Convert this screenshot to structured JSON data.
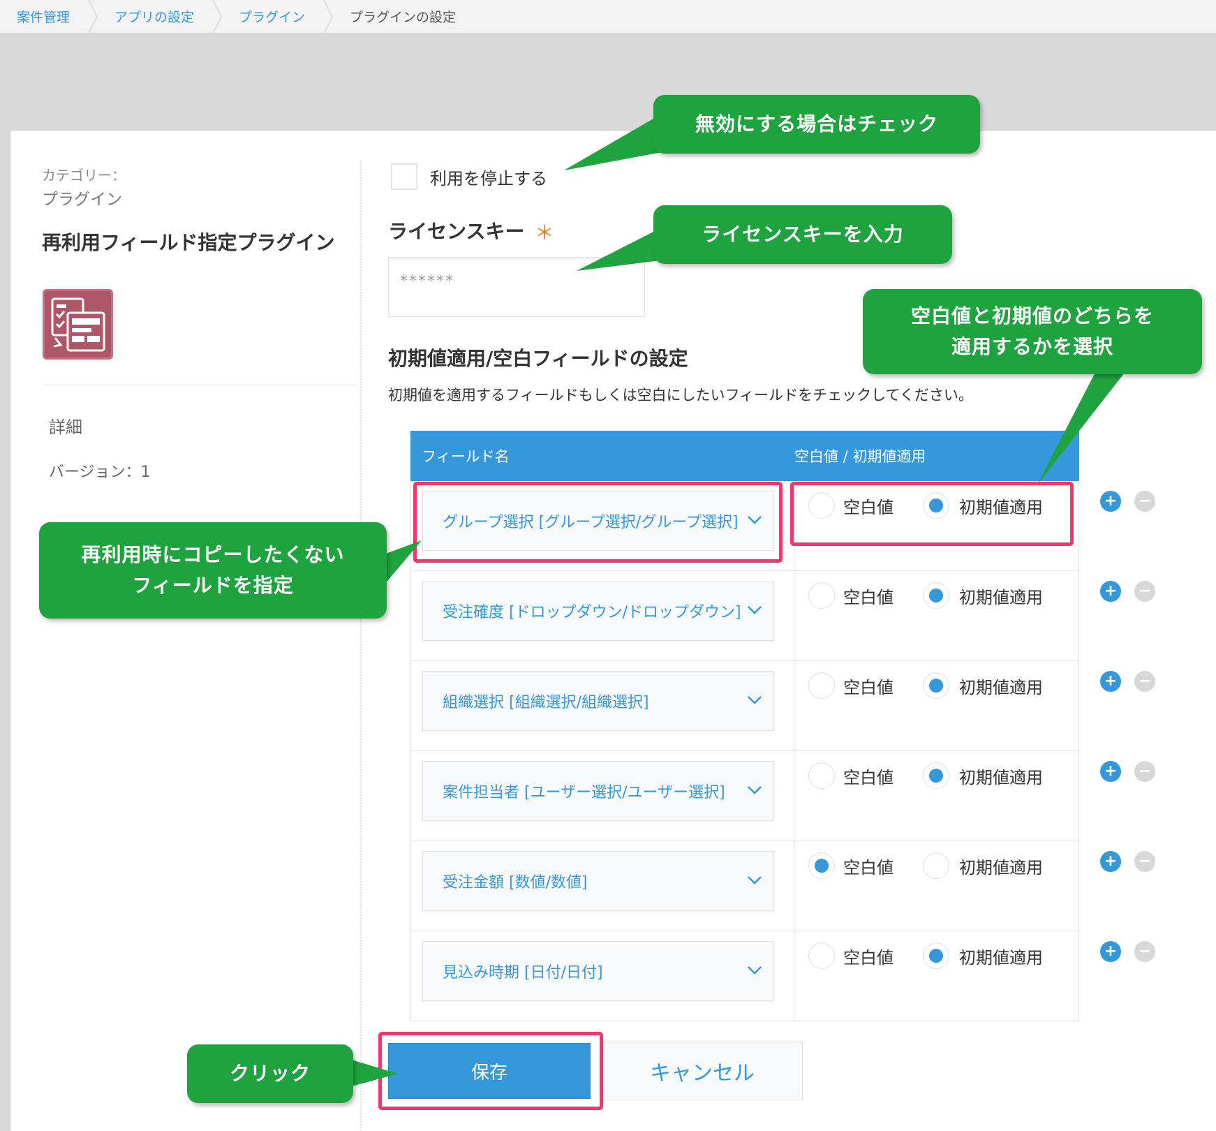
{
  "breadcrumb": [
    "案件管理",
    "アプリの設定",
    "プラグイン",
    "プラグインの設定"
  ],
  "sidebar": {
    "category_label": "カテゴリー：",
    "category_value": "プラグイン",
    "plugin_title": "再利用フィールド指定プラグイン",
    "plugin_icon": "form-copy-icon",
    "detail_label": "詳細",
    "version": "バージョン：1"
  },
  "form": {
    "stop_label": "利用を停止する",
    "stop_checked": false,
    "license_heading": "ライセンスキー",
    "required_mark": "＊",
    "license_value": "******",
    "section_heading": "初期値適用/空白フィールドの設定",
    "section_desc": "初期値を適用するフィールドもしくは空白にしたいフィールドをチェックしてください。"
  },
  "table": {
    "col_field": "フィールド名",
    "col_mode": "空白値 / 初期値適用",
    "blank_label": "空白値",
    "default_label": "初期値適用",
    "rows": [
      {
        "field": "グループ選択 [グループ選択/グループ選択]",
        "mode": "default"
      },
      {
        "field": "受注確度 [ドロップダウン/ドロップダウン]",
        "mode": "default"
      },
      {
        "field": "組織選択 [組織選択/組織選択]",
        "mode": "default"
      },
      {
        "field": "案件担当者 [ユーザー選択/ユーザー選択]",
        "mode": "default"
      },
      {
        "field": "受注金額 [数値/数値]",
        "mode": "blank"
      },
      {
        "field": "見込み時期 [日付/日付]",
        "mode": "default"
      }
    ]
  },
  "buttons": {
    "save": "保存",
    "cancel": "キャンセル"
  },
  "callouts": {
    "disable": "無効にする場合はチェック",
    "license": "ライセンスキーを入力",
    "select_mode_line1": "空白値と初期値のどちらを",
    "select_mode_line2": "適用するかを選択",
    "no_copy_line1": "再利用時にコピーしたくない",
    "no_copy_line2": "フィールドを指定",
    "click": "クリック"
  },
  "colors": {
    "accent": "#3498db",
    "callout": "#1ea33e",
    "highlight": "#f0386b"
  }
}
